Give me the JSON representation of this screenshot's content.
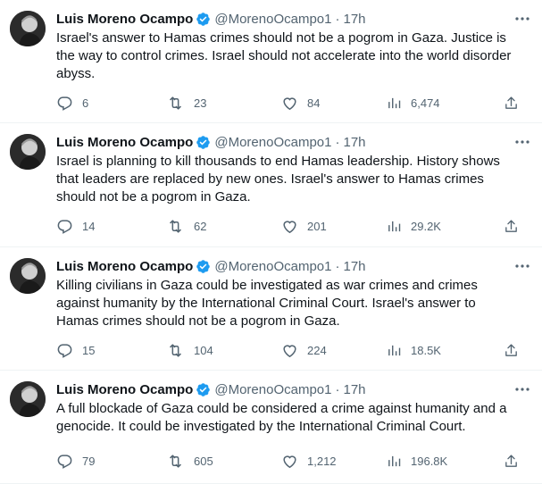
{
  "colors": {
    "accent": "#1d9bf0",
    "text": "#0f1419",
    "muted": "#536471",
    "divider": "#eff3f4"
  },
  "tweets": [
    {
      "name": "Luis Moreno Ocampo",
      "handle": "@MorenoOcampo1",
      "sep": "·",
      "time": "17h",
      "text": "Israel's answer to Hamas crimes should not be a pogrom in Gaza. Justice is the way to control crimes. Israel should not accelerate into the world disorder abyss.",
      "replies": "6",
      "retweets": "23",
      "likes": "84",
      "views": "6,474"
    },
    {
      "name": "Luis Moreno Ocampo",
      "handle": "@MorenoOcampo1",
      "sep": "·",
      "time": "17h",
      "text": "Israel is planning to kill thousands to end Hamas leadership. History shows that leaders are replaced by new ones. Israel's answer to Hamas crimes should not be a pogrom in Gaza.",
      "replies": "14",
      "retweets": "62",
      "likes": "201",
      "views": "29.2K"
    },
    {
      "name": "Luis Moreno Ocampo",
      "handle": "@MorenoOcampo1",
      "sep": "·",
      "time": "17h",
      "text": "Killing civilians in Gaza could be investigated as war crimes and crimes against humanity by the International Criminal Court. Israel's answer to Hamas crimes should not be a pogrom in Gaza.",
      "replies": "15",
      "retweets": "104",
      "likes": "224",
      "views": "18.5K"
    },
    {
      "name": "Luis Moreno Ocampo",
      "handle": "@MorenoOcampo1",
      "sep": "·",
      "time": "17h",
      "text": "A full blockade of Gaza could be considered a crime against humanity and a genocide. It could be investigated by the International Criminal Court.",
      "replies": "79",
      "retweets": "605",
      "likes": "1,212",
      "views": "196.8K"
    }
  ]
}
